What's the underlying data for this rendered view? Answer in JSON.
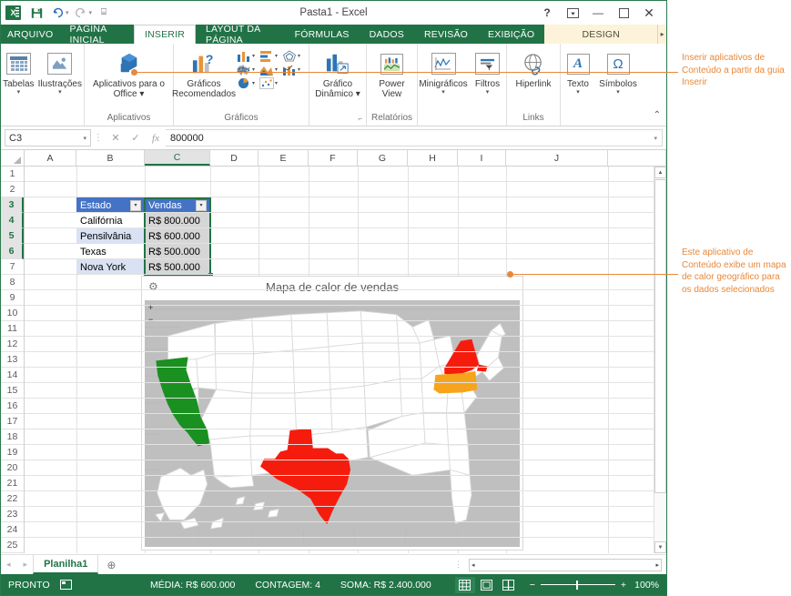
{
  "window": {
    "title": "Pasta1 - Excel",
    "logo_text": "X",
    "quick_access": [
      {
        "name": "save",
        "glyph": "⬜"
      },
      {
        "name": "undo",
        "glyph": "↶"
      },
      {
        "name": "redo",
        "glyph": "↷"
      },
      {
        "name": "customize",
        "glyph": "☰"
      }
    ],
    "controls": [
      {
        "name": "help",
        "glyph": "?"
      },
      {
        "name": "ribbon-display-options",
        "glyph": "⬆"
      },
      {
        "name": "minimize",
        "glyph": "—"
      },
      {
        "name": "maximize",
        "glyph": "☐"
      },
      {
        "name": "close",
        "glyph": "✕"
      }
    ]
  },
  "tabs": {
    "file": "ARQUIVO",
    "items": [
      {
        "label": "PÁGINA INICIAL",
        "active": false
      },
      {
        "label": "INSERIR",
        "active": true
      },
      {
        "label": "LAYOUT DA PÁGINA",
        "active": false
      },
      {
        "label": "FÓRMULAS",
        "active": false
      },
      {
        "label": "DADOS",
        "active": false
      },
      {
        "label": "REVISÃO",
        "active": false
      },
      {
        "label": "EXIBIÇÃO",
        "active": false
      }
    ],
    "contextual": "DESIGN",
    "overflow_glyph": "▸"
  },
  "ribbon": {
    "groups": [
      {
        "label": "",
        "buttons": [
          {
            "label": "Tabelas",
            "caret": "▾",
            "icon": "table-icon"
          },
          {
            "label": "Ilustrações",
            "caret": "▾",
            "icon": "illustrations-icon"
          }
        ]
      },
      {
        "label": "Aplicativos",
        "buttons": [
          {
            "label": "Aplicativos para o Office ▾",
            "caret": "",
            "icon": "office-apps-icon"
          }
        ]
      },
      {
        "label": "Gráficos",
        "buttons": [
          {
            "label": "Gráficos Recomendados",
            "caret": "",
            "icon": "recommended-charts-icon"
          }
        ],
        "chart_icons": [
          "column-chart-icon",
          "bar-chart-icon",
          "radar-chart-icon",
          "line-chart-icon",
          "area-chart-icon",
          "combo-chart-icon",
          "pie-chart-icon",
          "scatter-chart-icon"
        ],
        "dialog_launcher": "⬌"
      },
      {
        "label": "",
        "buttons": [
          {
            "label": "Gráfico Dinâmico ▾",
            "caret": "",
            "icon": "pivot-chart-icon"
          }
        ]
      },
      {
        "label": "Relatórios",
        "buttons": [
          {
            "label": "Power View",
            "caret": "",
            "icon": "power-view-icon"
          }
        ]
      },
      {
        "label": "",
        "buttons": [
          {
            "label": "Minigráficos",
            "caret": "▾",
            "icon": "sparklines-icon"
          },
          {
            "label": "Filtros",
            "caret": "▾",
            "icon": "filters-icon"
          }
        ]
      },
      {
        "label": "Links",
        "buttons": [
          {
            "label": "Hiperlink",
            "caret": "",
            "icon": "hyperlink-icon"
          }
        ]
      },
      {
        "label": "",
        "buttons": [
          {
            "label": "Texto",
            "caret": "▾",
            "icon": "text-icon"
          },
          {
            "label": "Símbolos",
            "caret": "▾",
            "icon": "symbols-icon"
          }
        ]
      }
    ],
    "collapse_glyph": "⌃"
  },
  "formula_bar": {
    "name_box_value": "C3",
    "name_box_caret": "▾",
    "cancel_glyph": "✕",
    "enter_glyph": "✓",
    "function_glyph": "fx",
    "formula_value": "800000",
    "expand_caret": "▾"
  },
  "grid": {
    "columns": [
      "A",
      "B",
      "C",
      "D",
      "E",
      "F",
      "G",
      "H",
      "I",
      "J"
    ],
    "selected_column": "C",
    "rows": [
      1,
      2,
      3,
      4,
      5,
      6,
      7,
      8,
      9,
      10,
      11,
      12,
      13,
      14,
      15,
      16,
      17,
      18,
      19,
      20,
      21,
      22,
      23,
      24,
      25
    ],
    "selected_rows": [
      3,
      4,
      5,
      6
    ]
  },
  "table": {
    "headers": [
      "Estado",
      "Vendas"
    ],
    "filter_glyph": "▾",
    "rows": [
      {
        "estado": "Califórnia",
        "vendas": "R$ 800.000"
      },
      {
        "estado": "Pensilvânia",
        "vendas": "R$ 600.000"
      },
      {
        "estado": "Texas",
        "vendas": "R$ 500.000"
      },
      {
        "estado": "Nova York",
        "vendas": "R$ 500.000"
      }
    ]
  },
  "app_object": {
    "title": "Mapa de calor de vendas",
    "settings_glyph": "⚙",
    "zoom_in": "+",
    "zoom_out": "−",
    "background_color": "#bfbfbf",
    "state_default_color": "#ffffff",
    "highlights": [
      {
        "state": "Califórnia",
        "color": "#1a9020",
        "value": "R$ 800.000"
      },
      {
        "state": "Texas",
        "color": "#f61c0d",
        "value": "R$ 500.000"
      },
      {
        "state": "Nova York",
        "color": "#f61c0d",
        "value": "R$ 500.000"
      },
      {
        "state": "Pensilvânia",
        "color": "#f7a41d",
        "value": "R$ 600.000"
      }
    ]
  },
  "sheet_tabs": {
    "prev_glyph": "◂",
    "next_glyph": "▸",
    "sheets": [
      "Planilha1"
    ],
    "add_glyph": "⊕",
    "dots_glyph": "⋮",
    "hscroll_left": "◂",
    "hscroll_right": "▸"
  },
  "status_bar": {
    "mode": "PRONTO",
    "macro_icon": "record-macro-icon",
    "stats": [
      "MÉDIA: R$ 600.000",
      "CONTAGEM: 4",
      "SOMA: R$ 2.400.000"
    ],
    "views": [
      {
        "name": "normal-view",
        "glyph": "▦",
        "active": true
      },
      {
        "name": "page-layout-view",
        "glyph": "▣",
        "active": false
      },
      {
        "name": "page-break-view",
        "glyph": "▤",
        "active": false
      }
    ],
    "zoom_out": "−",
    "zoom_in": "+",
    "zoom_level": "100%"
  },
  "callouts": [
    {
      "text": "Inserir aplicativos de Conteúdo a partir da guia Inserir"
    },
    {
      "text": "Este aplicativo de Conteúdo exibe um mapa de calor geográfico para os dados selecionados"
    }
  ],
  "colors": {
    "excel_green": "#217346",
    "table_header_blue": "#4472c4",
    "table_band_blue": "#d9e2f3",
    "callout_orange": "#e8883a",
    "contextual_tab": "#fdf3da"
  }
}
